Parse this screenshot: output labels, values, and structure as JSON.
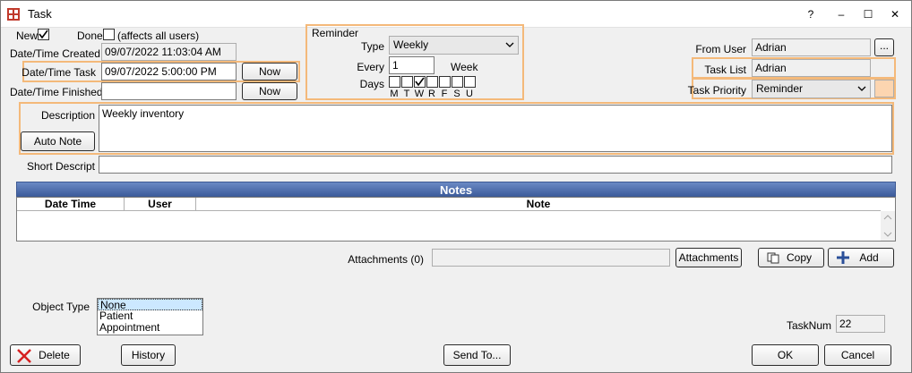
{
  "window": {
    "title": "Task",
    "help_glyph": "?",
    "minimize_glyph": "–",
    "maximize_glyph": "☐",
    "close_glyph": "✕"
  },
  "top": {
    "new_label": "New",
    "done_label": "Done",
    "done_note": "(affects all users)",
    "created_label": "Date/Time Created",
    "created_value": "09/07/2022 11:03:04 AM",
    "task_label": "Date/Time Task",
    "task_value": "09/07/2022 5:00:00 PM",
    "finished_label": "Date/Time Finished",
    "finished_value": "",
    "now_label": "Now"
  },
  "reminder": {
    "group_label": "Reminder",
    "type_label": "Type",
    "type_value": "Weekly",
    "every_label": "Every",
    "every_value": "1",
    "every_unit": "Week",
    "days_label": "Days",
    "days": [
      {
        "letter": "M",
        "checked": false
      },
      {
        "letter": "T",
        "checked": false
      },
      {
        "letter": "W",
        "checked": true
      },
      {
        "letter": "R",
        "checked": false
      },
      {
        "letter": "F",
        "checked": false
      },
      {
        "letter": "S",
        "checked": false
      },
      {
        "letter": "U",
        "checked": false
      }
    ]
  },
  "right": {
    "from_user_label": "From User",
    "from_user_value": "Adrian",
    "from_user_button": "...",
    "task_list_label": "Task List",
    "task_list_value": "Adrian",
    "priority_label": "Task Priority",
    "priority_value": "Reminder",
    "priority_color": "#fcd5b0"
  },
  "description": {
    "label": "Description",
    "value": "Weekly inventory",
    "auto_note_label": "Auto Note",
    "short_label": "Short Descript",
    "short_value": ""
  },
  "notes": {
    "title": "Notes",
    "columns": [
      "Date Time",
      "User",
      "Note"
    ]
  },
  "attachments": {
    "label": "Attachments (0)",
    "value": "",
    "button_label": "Attachments",
    "copy_label": "Copy",
    "add_label": "Add"
  },
  "object_type": {
    "label": "Object Type",
    "options": [
      "None",
      "Patient",
      "Appointment"
    ],
    "selected": "None"
  },
  "tasknum": {
    "label": "TaskNum",
    "value": "22"
  },
  "footer": {
    "delete_label": "Delete",
    "history_label": "History",
    "send_to_label": "Send To...",
    "ok_label": "OK",
    "cancel_label": "Cancel"
  },
  "colors": {
    "highlight_border": "#f4b97a",
    "notes_header": "#4a6aab"
  }
}
